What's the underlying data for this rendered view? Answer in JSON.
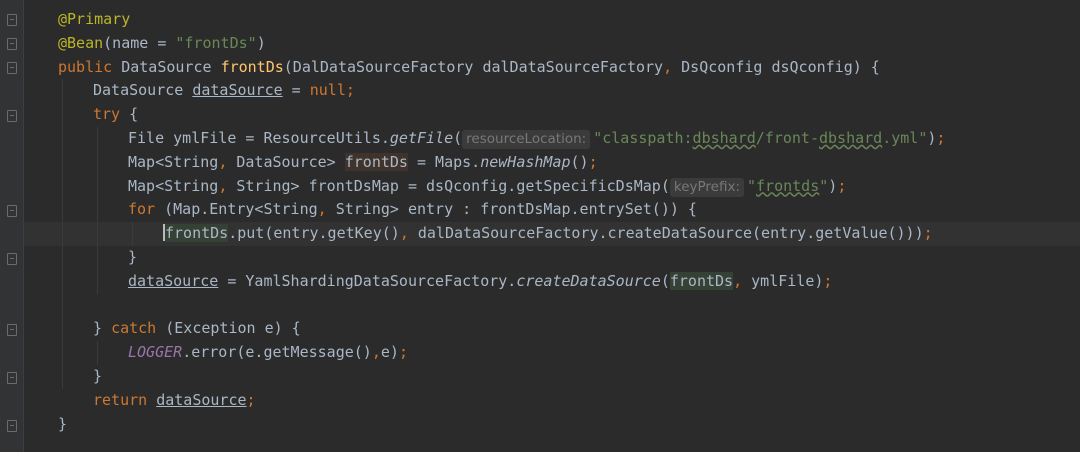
{
  "editor": {
    "lines": [
      {
        "indent": 0,
        "segments": [
          {
            "t": "@Primary",
            "c": "ann"
          }
        ]
      },
      {
        "indent": 0,
        "segments": [
          {
            "t": "@Bean",
            "c": "ann"
          },
          {
            "t": "(name = "
          },
          {
            "t": "\"frontDs\"",
            "c": "str"
          },
          {
            "t": ")"
          }
        ]
      },
      {
        "indent": 0,
        "segments": [
          {
            "t": "public ",
            "c": "kw"
          },
          {
            "t": "DataSource "
          },
          {
            "t": "frontDs",
            "c": "fn"
          },
          {
            "t": "(DalDataSourceFactory dalDataSourceFactory"
          },
          {
            "t": ", ",
            "c": "kw"
          },
          {
            "t": "DsQconfig dsQconfig) {"
          }
        ]
      },
      {
        "indent": 1,
        "segments": [
          {
            "t": "DataSource "
          },
          {
            "t": "dataSource",
            "c": "ul"
          },
          {
            "t": " = "
          },
          {
            "t": "null;",
            "c": "kw"
          }
        ]
      },
      {
        "indent": 1,
        "segments": [
          {
            "t": "try ",
            "c": "kw"
          },
          {
            "t": "{"
          }
        ]
      },
      {
        "indent": 2,
        "segments": [
          {
            "t": "File ymlFile = ResourceUtils."
          },
          {
            "t": "getFile",
            "c": "it"
          },
          {
            "t": "("
          },
          {
            "t": "resourceLocation:",
            "c": "hint"
          },
          {
            "t": "\"classpath:",
            "c": "str"
          },
          {
            "t": "dbshard",
            "c": "str squig"
          },
          {
            "t": "/front-",
            "c": "str"
          },
          {
            "t": "dbshard",
            "c": "str squig"
          },
          {
            "t": ".yml\"",
            "c": "str"
          },
          {
            "t": ")"
          },
          {
            "t": ";",
            "c": "kw"
          }
        ]
      },
      {
        "indent": 2,
        "segments": [
          {
            "t": "Map<String"
          },
          {
            "t": ", ",
            "c": "kw"
          },
          {
            "t": "DataSource> "
          },
          {
            "t": "frontDs",
            "c": "var-hl2"
          },
          {
            "t": " = Maps."
          },
          {
            "t": "newHashMap",
            "c": "it"
          },
          {
            "t": "()"
          },
          {
            "t": ";",
            "c": "kw"
          }
        ]
      },
      {
        "indent": 2,
        "segments": [
          {
            "t": "Map<String"
          },
          {
            "t": ", ",
            "c": "kw"
          },
          {
            "t": "String> frontDsMap = dsQconfig.getSpecificDsMap("
          },
          {
            "t": "keyPrefix:",
            "c": "hint"
          },
          {
            "t": "\"",
            "c": "str"
          },
          {
            "t": "frontds",
            "c": "str squig"
          },
          {
            "t": "\"",
            "c": "str"
          },
          {
            "t": ")"
          },
          {
            "t": ";",
            "c": "kw"
          }
        ]
      },
      {
        "indent": 2,
        "segments": [
          {
            "t": "for ",
            "c": "kw"
          },
          {
            "t": "(Map.Entry<String"
          },
          {
            "t": ", ",
            "c": "kw"
          },
          {
            "t": "String> entry : frontDsMap.entrySet()) {"
          }
        ]
      },
      {
        "indent": 3,
        "current": true,
        "segments": [
          {
            "t": "",
            "c": "caret"
          },
          {
            "t": "frontDs",
            "c": "var-hl"
          },
          {
            "t": ".put(entry.getKey()"
          },
          {
            "t": ", ",
            "c": "kw"
          },
          {
            "t": "dalDataSourceFactory.createDataSource(entry.getValue()))"
          },
          {
            "t": ";",
            "c": "kw"
          }
        ]
      },
      {
        "indent": 2,
        "segments": [
          {
            "t": "}"
          }
        ]
      },
      {
        "indent": 2,
        "segments": [
          {
            "t": "dataSource",
            "c": "ul"
          },
          {
            "t": " = YamlShardingDataSourceFactory."
          },
          {
            "t": "createDataSource",
            "c": "it"
          },
          {
            "t": "("
          },
          {
            "t": "frontDs",
            "c": "var-hl"
          },
          {
            "t": ", ",
            "c": "kw"
          },
          {
            "t": "ymlFile)"
          },
          {
            "t": ";",
            "c": "kw"
          }
        ]
      },
      {
        "indent": 0,
        "segments": []
      },
      {
        "indent": 1,
        "segments": [
          {
            "t": "} "
          },
          {
            "t": "catch ",
            "c": "kw"
          },
          {
            "t": "(Exception e) {"
          }
        ]
      },
      {
        "indent": 2,
        "segments": [
          {
            "t": "LOGGER",
            "c": "fld"
          },
          {
            "t": ".error(e.getMessage()"
          },
          {
            "t": ",",
            "c": "kw"
          },
          {
            "t": "e)"
          },
          {
            "t": ";",
            "c": "kw"
          }
        ]
      },
      {
        "indent": 1,
        "segments": [
          {
            "t": "}"
          }
        ]
      },
      {
        "indent": 1,
        "segments": [
          {
            "t": "return ",
            "c": "kw"
          },
          {
            "t": "dataSource",
            "c": "ul"
          },
          {
            "t": ";",
            "c": "kw"
          }
        ]
      },
      {
        "indent": 0,
        "segments": [
          {
            "t": "}"
          }
        ]
      }
    ]
  }
}
